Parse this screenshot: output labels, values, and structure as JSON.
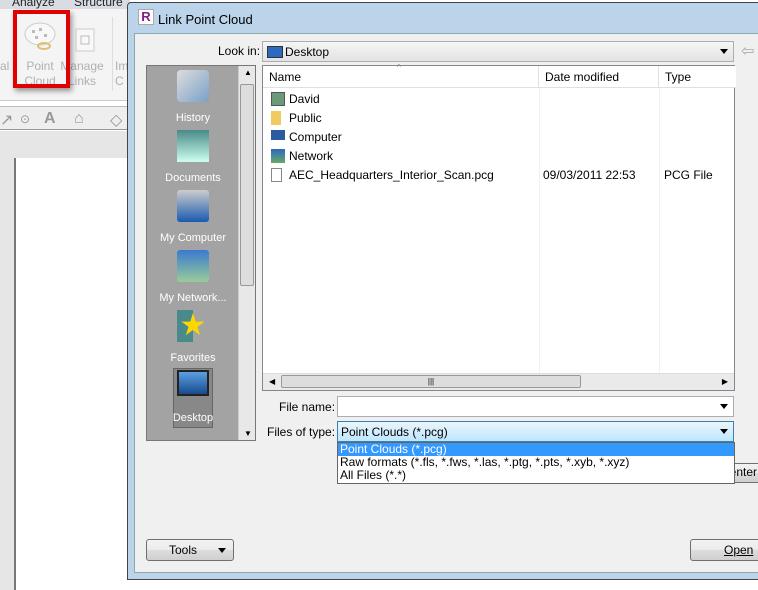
{
  "ribbon": {
    "tabs": [
      "Analyze",
      "Structure"
    ],
    "buttons": [
      {
        "label_line1": "Point",
        "label_line2": "Cloud",
        "icon": "point-cloud-icon",
        "highlighted": true
      },
      {
        "label_line1": "Manage",
        "label_line2": "Links",
        "icon": "manage-links-icon"
      },
      {
        "label_line1": "Im",
        "label_line2": "C",
        "icon": "import-icon"
      }
    ],
    "highlight_color": "#e00000"
  },
  "dialog": {
    "title": "Link Point Cloud",
    "look_in_label": "Look in:",
    "look_in_value": "Desktop",
    "places": [
      {
        "label": "History",
        "icon": "history-icon"
      },
      {
        "label": "Documents",
        "icon": "documents-icon"
      },
      {
        "label": "My Computer",
        "icon": "my-computer-icon"
      },
      {
        "label": "My Network...",
        "icon": "network-icon"
      },
      {
        "label": "Favorites",
        "icon": "favorites-icon"
      },
      {
        "label": "Desktop",
        "icon": "desktop-icon",
        "selected": true
      }
    ],
    "columns": [
      "Name",
      "Date modified",
      "Type"
    ],
    "files": [
      {
        "name": "David",
        "date": "",
        "type": "",
        "icon": "user-folder-icon"
      },
      {
        "name": "Public",
        "date": "",
        "type": "",
        "icon": "folder-icon"
      },
      {
        "name": "Computer",
        "date": "",
        "type": "",
        "icon": "computer-icon"
      },
      {
        "name": "Network",
        "date": "",
        "type": "",
        "icon": "network-icon"
      },
      {
        "name": "AEC_Headquarters_Interior_Scan.pcg",
        "date": "09/03/2011 22:53",
        "type": "PCG File",
        "icon": "file-icon"
      }
    ],
    "file_name_label": "File name:",
    "file_name_value": "",
    "files_of_type_label": "Files of type:",
    "files_of_type_value": "Point Clouds (*.pcg)",
    "files_of_type_options": [
      "Point Clouds (*.pcg)",
      "Raw formats (*.fls, *.fws, *.las, *.ptg, *.pts, *.xyb, *.xyz)",
      "All Files (*.*)"
    ],
    "hidden_button_partial": "enter",
    "tools_label": "Tools",
    "open_label": "Open",
    "selection_color": "#3399ff"
  }
}
